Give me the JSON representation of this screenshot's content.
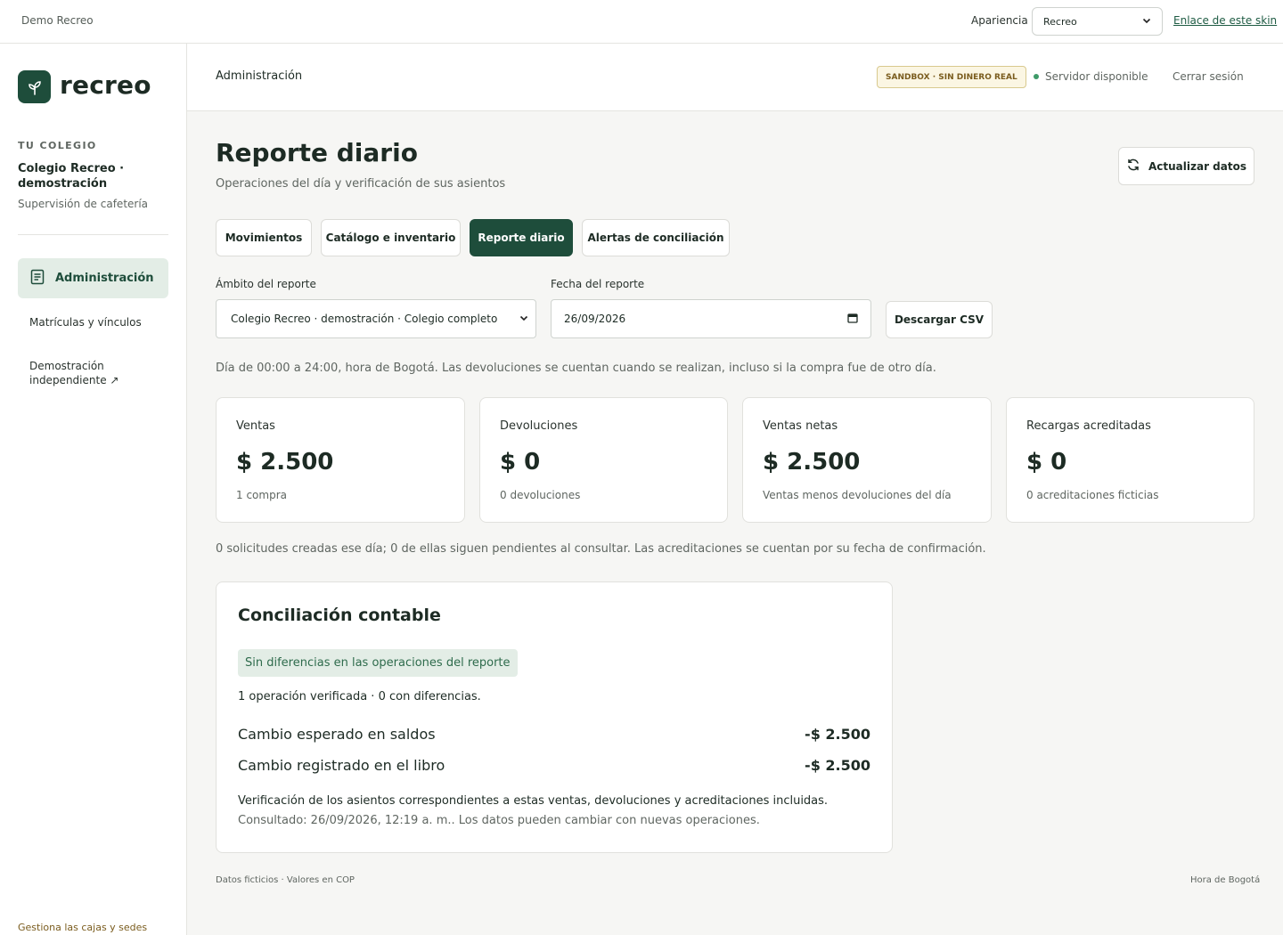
{
  "topbar": {
    "demo_label": "Demo Recreo",
    "appearance_label": "Apariencia",
    "skin_selected": "Recreo",
    "skin_link": "Enlace de este skin"
  },
  "sidebar": {
    "logo_text": "recreo",
    "school_caption": "TU COLEGIO",
    "school_name": "Colegio Recreo · demostración",
    "school_role": "Supervisión de cafetería",
    "nav": [
      {
        "label": "Administración",
        "active": true,
        "icon": "document-icon"
      },
      {
        "label": "Matrículas y vínculos",
        "active": false
      },
      {
        "label": "Demostración independiente ↗",
        "active": false
      }
    ],
    "footer_link": "Gestiona las cajas y sedes"
  },
  "header": {
    "section": "Administración",
    "sandbox_badge": "SANDBOX · SIN DINERO REAL",
    "server_status": "Servidor disponible",
    "logout": "Cerrar sesión"
  },
  "page": {
    "title": "Reporte diario",
    "subtitle": "Operaciones del día y verificación de sus asientos",
    "refresh_label": "Actualizar datos"
  },
  "tabs": [
    {
      "label": "Movimientos",
      "active": false
    },
    {
      "label": "Catálogo e inventario",
      "active": false
    },
    {
      "label": "Reporte diario",
      "active": true
    },
    {
      "label": "Alertas de conciliación",
      "active": false
    }
  ],
  "form": {
    "scope_label": "Ámbito del reporte",
    "scope_value": "Colegio Recreo · demostración · Colegio completo",
    "date_label": "Fecha del reporte",
    "date_value": "26/09/2026",
    "csv_label": "Descargar CSV"
  },
  "notes": {
    "day_range": "Día de 00:00 a 24:00, hora de Bogotá. Las devoluciones se cuentan cuando se realizan, incluso si la compra fue de otro día.",
    "requests": "0 solicitudes creadas ese día; 0 de ellas siguen pendientes al consultar. Las acreditaciones se cuentan por su fecha de confirmación."
  },
  "cards": [
    {
      "label": "Ventas",
      "value": "$ 2.500",
      "sub": "1 compra"
    },
    {
      "label": "Devoluciones",
      "value": "$ 0",
      "sub": "0 devoluciones"
    },
    {
      "label": "Ventas netas",
      "value": "$ 2.500",
      "sub": "Ventas menos devoluciones del día"
    },
    {
      "label": "Recargas acreditadas",
      "value": "$ 0",
      "sub": "0 acreditaciones ficticias"
    }
  ],
  "reconciliation": {
    "title": "Conciliación contable",
    "badge": "Sin diferencias en las operaciones del reporte",
    "summary": "1 operación verificada · 0 con diferencias.",
    "rows": [
      {
        "label": "Cambio esperado en saldos",
        "amount": "-$ 2.500"
      },
      {
        "label": "Cambio registrado en el libro",
        "amount": "-$ 2.500"
      }
    ],
    "note": "Verificación de los asientos correspondientes a estas ventas, devoluciones y acreditaciones incluidas.",
    "stamp": "Consultado: 26/09/2026, 12:19 a. m.. Los datos pueden cambiar con nuevas operaciones."
  },
  "footer": {
    "left": "Datos ficticios · Valores en COP",
    "right": "Hora de Bogotá"
  },
  "colors": {
    "brand": "#1e4d3b",
    "active_bg": "#e3ede6",
    "status_ok": "#3e9a68",
    "sandbox_text": "#7a5c1e"
  }
}
